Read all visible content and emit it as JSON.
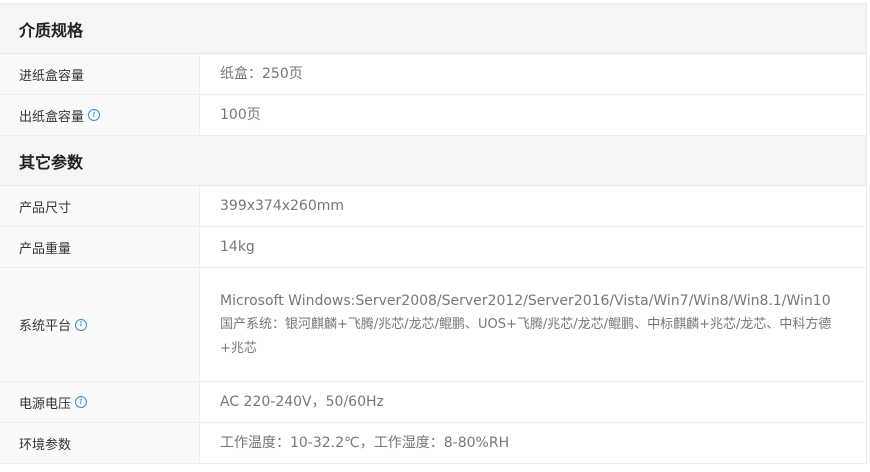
{
  "sections": {
    "media": {
      "title": "介质规格",
      "rows": [
        {
          "label": "进纸盒容量",
          "value": "纸盒：250页"
        },
        {
          "label": "出纸盒容量",
          "value": "100页"
        }
      ]
    },
    "other": {
      "title": "其它参数",
      "rows": [
        {
          "label": "产品尺寸",
          "value": "399x374x260mm"
        },
        {
          "label": "产品重量",
          "value": "14kg"
        },
        {
          "label": "系统平台",
          "value_line1": "Microsoft Windows:Server2008/Server2012/Server2016/Vista/Win7/Win8/Win8.1/Win10",
          "value_line2": "国产系统：银河麒麟+飞腾/兆芯/龙芯/鲲鹏、UOS+飞腾/兆芯/龙芯/鲲鹏、中标麒麟+兆芯/龙芯、中科方德+兆芯"
        },
        {
          "label": "电源电压",
          "value": "AC 220-240V，50/60Hz"
        },
        {
          "label": "环境参数",
          "value": "工作温度：10-32.2℃，工作湿度：8-80%RH"
        }
      ]
    }
  },
  "icons": {
    "info": "i"
  }
}
